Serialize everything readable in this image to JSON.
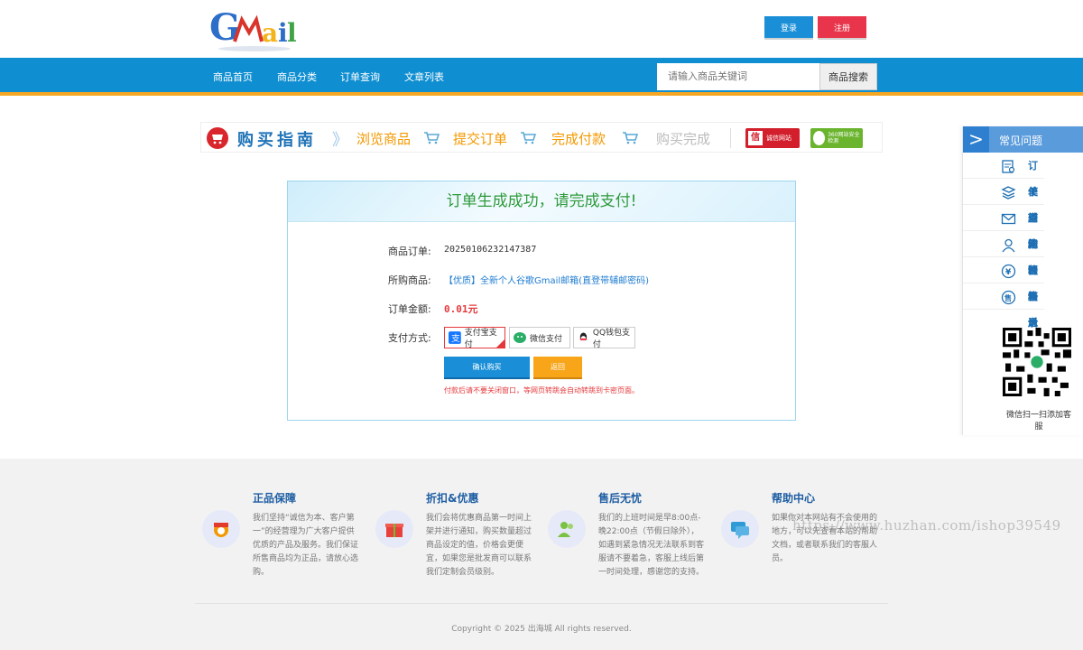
{
  "header": {
    "logo_text": "Gmail",
    "login_label": "登录",
    "register_label": "注册"
  },
  "nav": {
    "items": [
      "商品首页",
      "商品分类",
      "订单查询",
      "文章列表"
    ],
    "search_placeholder": "请输入商品关键词",
    "search_button": "商品搜索"
  },
  "guide": {
    "title": "购买指南",
    "steps": [
      "浏览商品",
      "提交订单",
      "完成付款",
      "购买完成"
    ],
    "badges": [
      "诚信网站",
      "360网站安全检测"
    ]
  },
  "faq": {
    "title": "常见问题",
    "items": [
      {
        "label": "订单查询",
        "icon": "order-search-icon"
      },
      {
        "label": "使用教程",
        "icon": "tutorial-icon"
      },
      {
        "label": "辅助邮箱",
        "icon": "mail-icon"
      },
      {
        "label": "无法登录",
        "icon": "user-icon"
      },
      {
        "label": "价格说明",
        "icon": "yen-icon"
      },
      {
        "label": "售后条款",
        "icon": "aftersale-icon"
      }
    ],
    "qr_caption": "微信扫一扫添加客服"
  },
  "order": {
    "heading": "订单生成成功，请完成支付!",
    "order_no_label": "商品订单:",
    "order_no": "20250106232147387",
    "product_label": "所购商品:",
    "product": "【优质】全新个人谷歌Gmail邮箱(直登带辅邮密码)",
    "amount_label": "订单金额:",
    "amount": "0.01元",
    "pay_label": "支付方式:",
    "pay_methods": [
      "支付宝支付",
      "微信支付",
      "QQ钱包支付"
    ],
    "confirm_label": "确认购买",
    "back_label": "返回",
    "warning": "付款后请不要关闭窗口，等网页转跳会自动转跳到卡密页面。"
  },
  "footer": {
    "features": [
      {
        "title": "正品保障",
        "text": "我们坚持“诚信为本、客户第一”的经营理为广大客户提供优质的产品及服务。我们保证所售商品均为正品，请放心选购。"
      },
      {
        "title": "折扣&优惠",
        "text": "我们会将优惠商品第一时间上架并进行通知，购买数量超过商品设定的值，价格会更便宜，如果您是批发商可以联系我们定制会员级别。"
      },
      {
        "title": "售后无忧",
        "text": "我们的上班时间是早8:00点-晚22:00点（节假日除外），如遇到紧急情况无法联系到客服请不要着急，客服上线后第一时间处理，感谢您的支持。"
      },
      {
        "title": "帮助中心",
        "text": "如果你对本网站有不会使用的地方，可以先查看本站的帮助文档，或者联系我们的客服人员。"
      }
    ],
    "copyright": "Copyright © 2025 出海城 All rights reserved.",
    "watermark": "https://www.huzhan.com/ishop39549"
  },
  "colors": {
    "nav_blue": "#0f8ed1",
    "nav_accent": "#f5a623",
    "success_green": "#2f9a3b",
    "price_red": "#e4393c"
  }
}
